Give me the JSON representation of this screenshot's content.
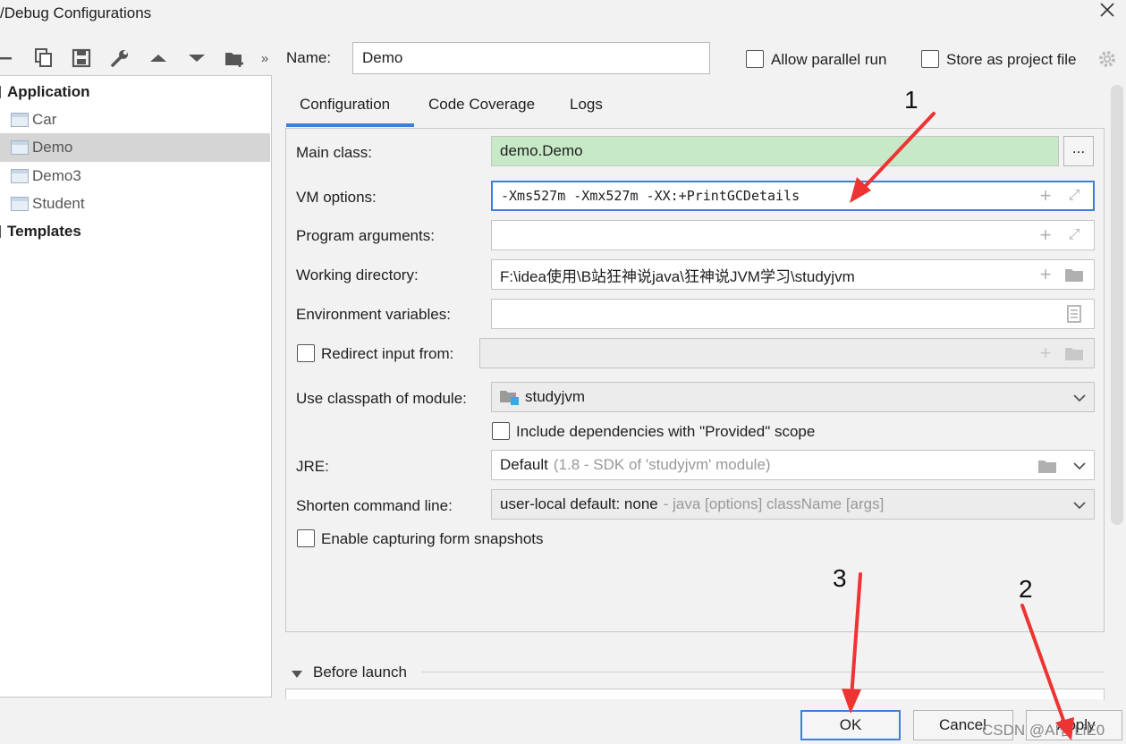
{
  "window": {
    "title": "/Debug Configurations"
  },
  "toolbar": {
    "icons": [
      "minus-icon",
      "copy-icon",
      "save-icon",
      "wrench-icon",
      "arrow-up-icon",
      "arrow-down-icon",
      "folder-add-icon",
      "more-icon"
    ]
  },
  "tree": {
    "group_application": "Application",
    "items": [
      {
        "label": "Car"
      },
      {
        "label": "Demo"
      },
      {
        "label": "Demo3"
      },
      {
        "label": "Student"
      }
    ],
    "group_templates": "Templates"
  },
  "header": {
    "name_label": "Name:",
    "name_value": "Demo",
    "allow_parallel": "Allow parallel run",
    "store_project": "Store as project file"
  },
  "tabs": [
    {
      "label": "Configuration"
    },
    {
      "label": "Code Coverage"
    },
    {
      "label": "Logs"
    }
  ],
  "form": {
    "main_class_label": "Main class:",
    "main_class_value": "demo.Demo",
    "browse_label": "...",
    "vm_options_label": "VM options:",
    "vm_options_value": "-Xms527m -Xmx527m -XX:+PrintGCDetails",
    "program_args_label": "Program arguments:",
    "program_args_value": "",
    "working_dir_label": "Working directory:",
    "working_dir_value": "F:\\idea使用\\B站狂神说java\\狂神说JVM学习\\studyjvm",
    "env_vars_label": "Environment variables:",
    "env_vars_value": "",
    "redirect_label": "Redirect input from:",
    "classpath_label": "Use classpath of module:",
    "classpath_value": "studyjvm",
    "include_deps_label": "Include dependencies with \"Provided\" scope",
    "jre_label": "JRE:",
    "jre_value": "Default",
    "jre_hint": "(1.8 - SDK of 'studyjvm' module)",
    "shorten_label": "Shorten command line:",
    "shorten_value": "user-local default: none",
    "shorten_hint": "- java [options] className [args]",
    "snapshots_label": "Enable capturing form snapshots"
  },
  "before_launch": {
    "label": "Before launch"
  },
  "buttons": {
    "ok": "OK",
    "cancel": "Cancel",
    "apply": "Apply"
  },
  "annotations": {
    "n1": "1",
    "n2": "2",
    "n3": "3"
  },
  "watermark": "CSDN @AI智LiE0",
  "colors": {
    "accent": "#3d7fd9",
    "selection": "#d5d5d5",
    "main_class_bg": "#c8e9c8",
    "arrow": "#ee3333"
  }
}
